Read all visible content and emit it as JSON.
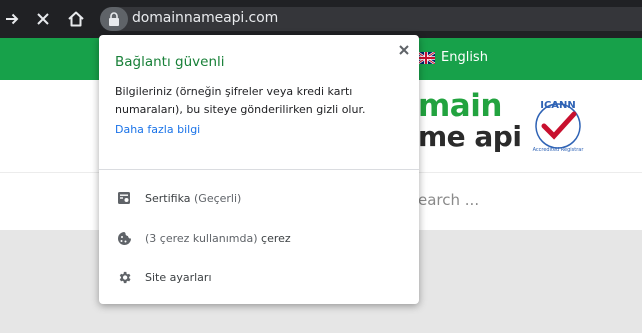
{
  "browser": {
    "url": "domainnameapi.com"
  },
  "site": {
    "language_label": "English",
    "logo_line1": "main",
    "logo_line2": "me api",
    "icann_top": "ICANN",
    "icann_bottom": "Accredited Registrar",
    "search_placeholder": "earch ..."
  },
  "popup": {
    "title": "Bağlantı güvenli",
    "description": "Bilgileriniz (örneğin şifreler veya kredi kartı numaraları), bu siteye gönderilirken gizli olur.",
    "learn_more": "Daha fazla bilgi",
    "items": [
      {
        "icon": "certificate-icon",
        "label": "Sertifika",
        "note": "(Geçerli)"
      },
      {
        "icon": "cookie-icon",
        "note": "(3 çerez kullanımda)",
        "label": "çerez"
      },
      {
        "icon": "gear-icon",
        "label": "Site ayarları"
      }
    ]
  },
  "colors": {
    "toolbar": "#202124",
    "site_green": "#17a14a",
    "secure_green": "#188038",
    "link_blue": "#1a73e8"
  }
}
